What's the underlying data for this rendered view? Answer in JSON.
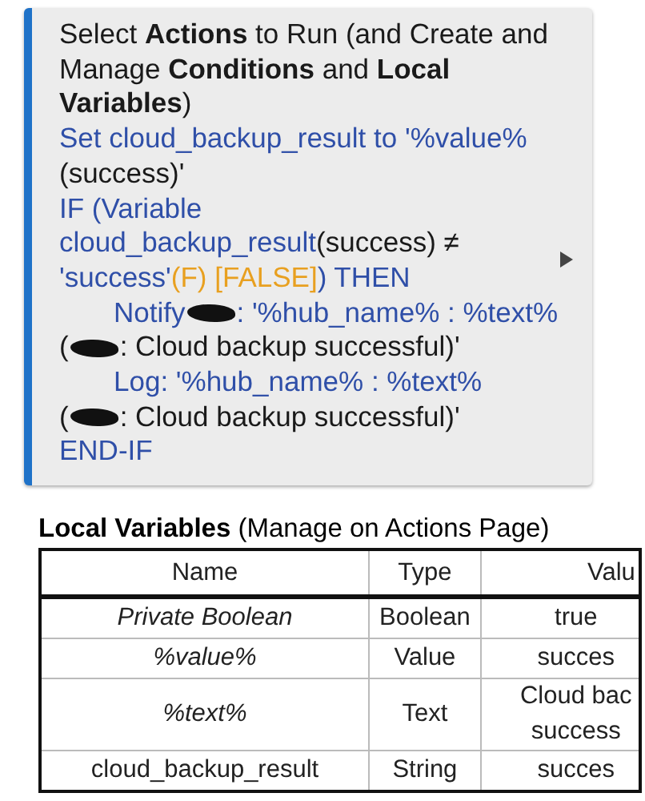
{
  "actions_card": {
    "lines": [
      {
        "indent": false,
        "segments": [
          {
            "kind": "text",
            "color": "#1a1a1a",
            "text": "Select **Actions** to Run (and Create and"
          }
        ]
      },
      {
        "indent": false,
        "segments": [
          {
            "kind": "text",
            "color": "#1a1a1a",
            "text": "Manage **Conditions** and **Local**"
          }
        ]
      },
      {
        "indent": false,
        "segments": [
          {
            "kind": "text",
            "color": "#1a1a1a",
            "text": "**Variables**)"
          }
        ]
      },
      {
        "indent": false,
        "segments": [
          {
            "kind": "text",
            "color": "#2f4fa8",
            "text": "Set cloud_backup_result to '%value%"
          }
        ]
      },
      {
        "indent": false,
        "segments": [
          {
            "kind": "text",
            "color": "#1a1a1a",
            "text": "(success)'"
          }
        ]
      },
      {
        "indent": false,
        "segments": [
          {
            "kind": "text",
            "color": "#2f4fa8",
            "text": "IF (Variable"
          }
        ]
      },
      {
        "indent": false,
        "segments": [
          {
            "kind": "text",
            "color": "#2f4fa8",
            "text": "cloud_backup_result"
          },
          {
            "kind": "text",
            "color": "#1a1a1a",
            "text": "(success) ≠"
          }
        ]
      },
      {
        "indent": false,
        "segments": [
          {
            "kind": "text",
            "color": "#2f4fa8",
            "text": "'success'"
          },
          {
            "kind": "text",
            "color": "#e8a020",
            "text": "(F) [FALSE]"
          },
          {
            "kind": "text",
            "color": "#2f4fa8",
            "text": ") THEN"
          }
        ]
      },
      {
        "indent": true,
        "segments": [
          {
            "kind": "text",
            "color": "#2f4fa8",
            "text": "Notify"
          },
          {
            "kind": "redacted"
          },
          {
            "kind": "text",
            "color": "#2f4fa8",
            "text": ": '%hub_name% : %text%"
          }
        ]
      },
      {
        "indent": false,
        "segments": [
          {
            "kind": "text",
            "color": "#1a1a1a",
            "text": "("
          },
          {
            "kind": "redacted"
          },
          {
            "kind": "text",
            "color": "#1a1a1a",
            "text": ": Cloud backup successful)'"
          }
        ]
      },
      {
        "indent": true,
        "segments": [
          {
            "kind": "text",
            "color": "#2f4fa8",
            "text": "Log: '%hub_name% : %text%"
          }
        ]
      },
      {
        "indent": false,
        "segments": [
          {
            "kind": "text",
            "color": "#1a1a1a",
            "text": "("
          },
          {
            "kind": "redacted"
          },
          {
            "kind": "text",
            "color": "#1a1a1a",
            "text": ": Cloud backup successful)'"
          }
        ]
      },
      {
        "indent": false,
        "segments": [
          {
            "kind": "text",
            "color": "#2f4fa8",
            "text": "END-IF"
          }
        ]
      }
    ]
  },
  "local_variables": {
    "title": "Local Variables",
    "subtitle": "(Manage on Actions Page)",
    "columns": [
      "Name",
      "Type",
      "Valu"
    ],
    "rows": [
      {
        "kind": "system",
        "name": "Private Boolean",
        "type": "Boolean",
        "value": "true"
      },
      {
        "kind": "system",
        "name": "%value%",
        "type": "Value",
        "value": "succes"
      },
      {
        "kind": "system",
        "name": "%text%",
        "type": "Text",
        "value": "Cloud bac success"
      },
      {
        "kind": "local",
        "name": "cloud_backup_result",
        "type": "String",
        "value": "succes"
      }
    ]
  }
}
